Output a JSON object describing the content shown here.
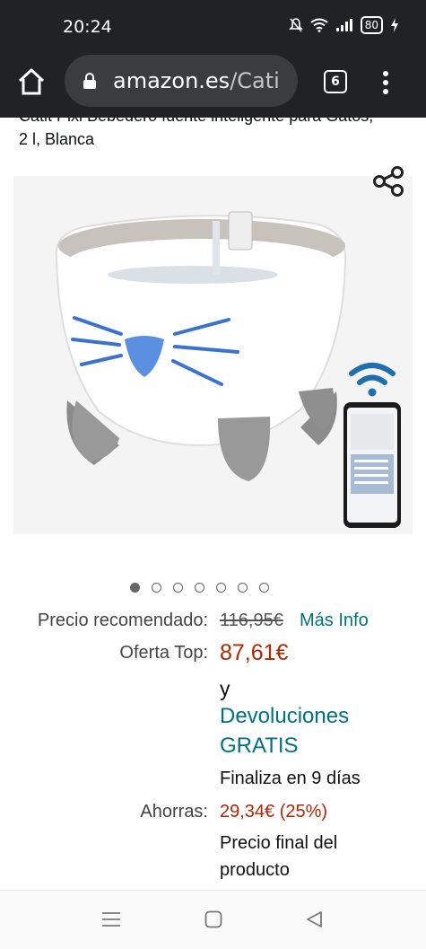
{
  "status_bar": {
    "time": "20:24",
    "battery": "80"
  },
  "browser": {
    "url_domain": "amazon.es",
    "url_rest": "/Cati",
    "tab_count": "6"
  },
  "product": {
    "title_line1": "Catit Pixi Bebedero fuente inteligente para Gatos,",
    "title_line2": "2 l, Blanca"
  },
  "pricing": {
    "recommended_label": "Precio recomendado:",
    "recommended_price": "116,95€",
    "more_info_link": "Más Info",
    "offer_label": "Oferta Top:",
    "offer_price": "87,61€",
    "and_text": "y",
    "returns_line1": "Devoluciones",
    "returns_line2": "GRATIS",
    "ends_text": "Finaliza en 9 días",
    "savings_label": "Ahorras:",
    "savings_value": "29,34€ (25%)",
    "final_line1": "Precio final del",
    "final_line2": "producto"
  },
  "gallery": {
    "image_count": 7,
    "active_index": 0
  },
  "colors": {
    "link": "#007185",
    "price": "#B12704",
    "chrome": "#202223"
  },
  "icons": [
    "home-icon",
    "lock-icon",
    "tabs-icon",
    "menu-icon",
    "share-icon",
    "wifi-icon",
    "recents-icon",
    "home-nav-icon",
    "back-icon"
  ]
}
